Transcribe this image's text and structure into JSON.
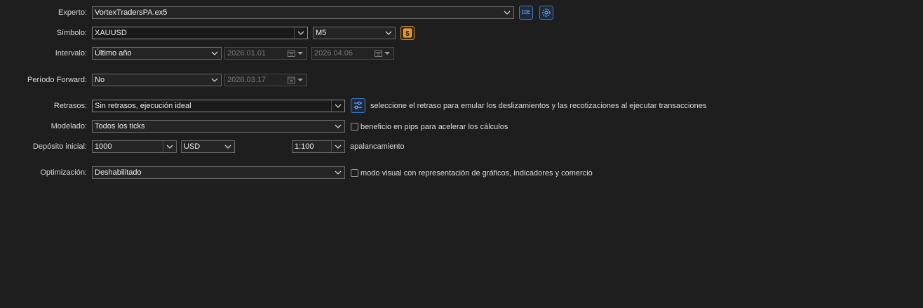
{
  "labels": {
    "expert": "Experto:",
    "symbol": "Símbolo:",
    "interval": "Intervalo:",
    "forward": "Período Forward:",
    "delays": "Retrasos:",
    "modeling": "Modelado:",
    "deposit": "Depósito inicial:",
    "optimization": "Optimización:"
  },
  "expert": {
    "value": "VortexTradersPA.ex5",
    "ide_label": "IDE"
  },
  "symbol": {
    "value": "XAUUSD",
    "timeframe": "M5"
  },
  "interval": {
    "value": "Último año",
    "from": "2026.01.01",
    "to": "2026.04.06"
  },
  "forward": {
    "value": "No",
    "date": "2026.03.17"
  },
  "delays": {
    "value": "Sin retrasos, ejecución ideal",
    "hint": "seleccione el retraso para emular los deslizamientos y las recotizaciones al ejecutar transacciones"
  },
  "modeling": {
    "value": "Todos los ticks",
    "pips_checkbox_label": "beneficio en pips para acelerar los cálculos",
    "pips_checked": false
  },
  "deposit": {
    "value": "1000",
    "currency": "USD",
    "leverage": "1:100",
    "leverage_label": "apalancamiento"
  },
  "optimization": {
    "value": "Deshabilitado",
    "visual_checkbox_label": "modo visual con representación de gráficos, indicadores y comercio",
    "visual_checked": false
  },
  "colors": {
    "background": "#1e1e1e",
    "field_border": "#6b6b6b",
    "icon_blue": "#3c78c8",
    "icon_gold": "#d08a2a"
  }
}
